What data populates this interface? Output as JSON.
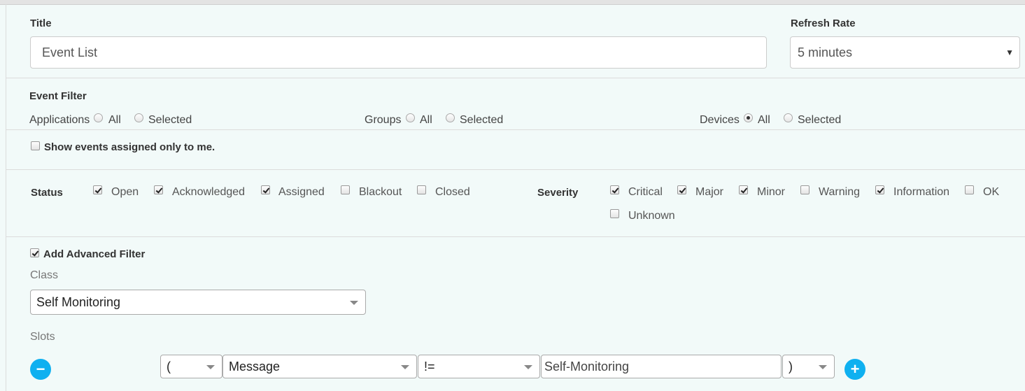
{
  "title_section": {
    "title_label": "Title",
    "title_value": "Event List",
    "refresh_label": "Refresh Rate",
    "refresh_value": "5 minutes"
  },
  "event_filter": {
    "heading": "Event Filter",
    "applications": {
      "label": "Applications",
      "all": "All",
      "selected": "Selected",
      "choice": "none"
    },
    "groups": {
      "label": "Groups",
      "all": "All",
      "selected": "Selected",
      "choice": "none"
    },
    "devices": {
      "label": "Devices",
      "all": "All",
      "selected": "Selected",
      "choice": "All"
    }
  },
  "assigned_only": {
    "label": "Show events assigned only to me.",
    "checked": false
  },
  "status": {
    "label": "Status",
    "options": [
      {
        "label": "Open",
        "checked": true
      },
      {
        "label": "Acknowledged",
        "checked": true
      },
      {
        "label": "Assigned",
        "checked": true
      },
      {
        "label": "Blackout",
        "checked": false
      },
      {
        "label": "Closed",
        "checked": false
      }
    ]
  },
  "severity": {
    "label": "Severity",
    "options": [
      {
        "label": "Critical",
        "checked": true
      },
      {
        "label": "Major",
        "checked": true
      },
      {
        "label": "Minor",
        "checked": true
      },
      {
        "label": "Warning",
        "checked": false
      },
      {
        "label": "Information",
        "checked": true
      },
      {
        "label": "OK",
        "checked": false
      },
      {
        "label": "Unknown",
        "checked": false
      }
    ]
  },
  "advanced": {
    "toggle_label": "Add Advanced Filter",
    "checked": true,
    "class_label": "Class",
    "class_value": "Self Monitoring",
    "slots_label": "Slots",
    "slot_row": {
      "open_paren": "(",
      "field": "Message",
      "operator": "!=",
      "value": "Self-Monitoring",
      "close_paren": ")"
    }
  },
  "icons": {
    "remove": "minus-circle-icon",
    "add": "plus-circle-icon",
    "accent": "#0fb0f0"
  }
}
